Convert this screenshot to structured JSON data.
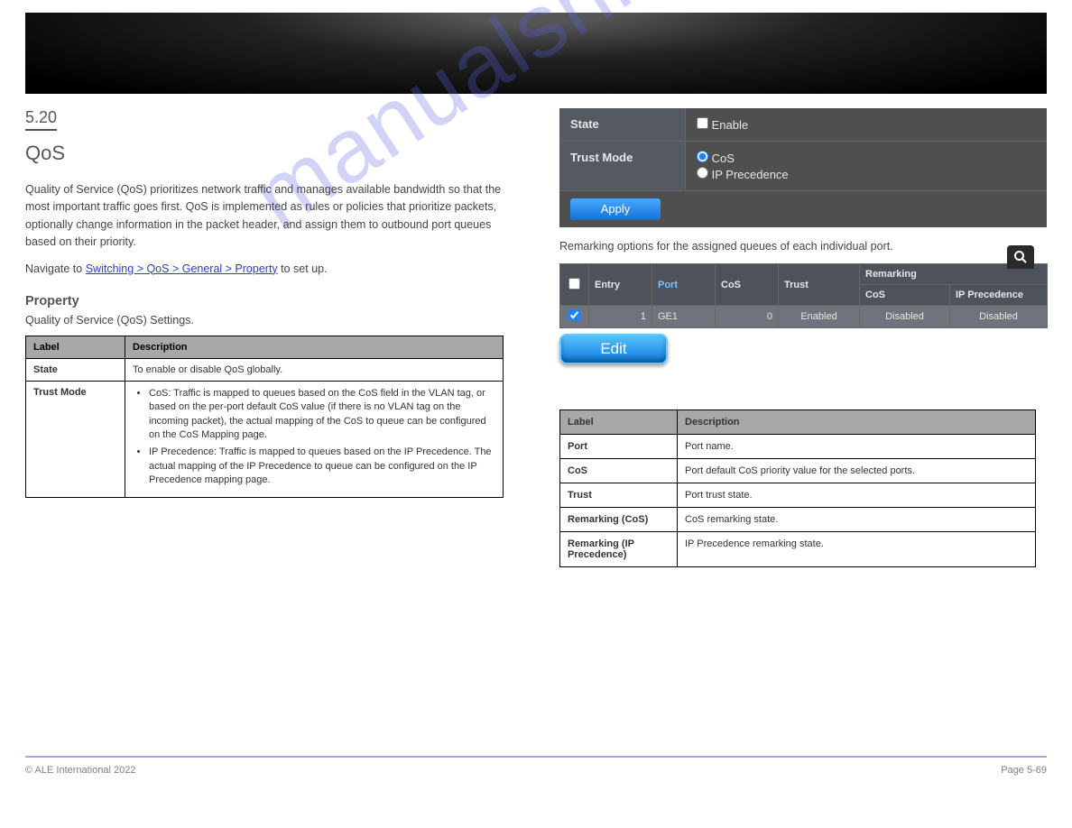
{
  "section": {
    "number": "5.20",
    "title": "QoS",
    "intro1": "Quality of Service (QoS) prioritizes network traffic and manages available bandwidth so that the most important traffic goes first. QoS is implemented as rules or policies that prioritize packets, optionally change information in the packet header, and assign them to outbound port queues based on their priority.",
    "intro2_pre": "Navigate to ",
    "intro2_link": "Switching > QoS > General > Property",
    "intro2_post": " to set up."
  },
  "left_sub": {
    "heading": "Property",
    "sub": "Quality of Service (QoS) Settings.",
    "table": {
      "head_label": "Label",
      "head_desc": "Description",
      "row1_label": "State",
      "row1_desc": "To enable or disable QoS globally.",
      "row2_label": "Trust Mode",
      "row2_items": [
        "CoS: Traffic is mapped to queues based on the CoS field in the VLAN tag, or based on the per-port default CoS value (if there is no VLAN tag on the incoming packet), the actual mapping of the CoS to queue can be configured on the CoS Mapping page.",
        "IP Precedence: Traffic is mapped to queues based on the IP Precedence. The actual mapping of the IP Precedence to queue can be configured on the IP Precedence mapping page."
      ]
    }
  },
  "settings": {
    "state_label": "State",
    "state_option": "Enable",
    "trust_label": "Trust Mode",
    "trust_cos": "CoS",
    "trust_ipprec": "IP Precedence",
    "apply": "Apply"
  },
  "right_caption": "Remarking options for the assigned queues of each individual port.",
  "grid": {
    "col_chk": "",
    "col_entry": "Entry",
    "col_port": "Port",
    "col_cos": "CoS",
    "col_trust": "Trust",
    "col_remarking": "Remarking",
    "col_rmk_cos": "CoS",
    "col_rmk_ipp": "IP Precedence",
    "row": {
      "entry": "1",
      "port": "GE1",
      "cos": "0",
      "trust": "Enabled",
      "rmk_cos": "Disabled",
      "rmk_ipp": "Disabled"
    },
    "edit": "Edit"
  },
  "port_table": {
    "head_label": "Label",
    "head_desc": "Description",
    "r1_label": "Port",
    "r1_desc": "Port name.",
    "r2_label": "CoS",
    "r2_desc": "Port default CoS priority value for the selected ports.",
    "r3_label": "Trust",
    "r3_desc": "Port trust state.",
    "r4_label": "Remarking (CoS)",
    "r4_desc": "CoS remarking state.",
    "r5_label": "Remarking (IP Precedence)",
    "r5_desc": "IP Precedence remarking state."
  },
  "footer": {
    "left": "© ALE International 2022",
    "right": "Page 5-69"
  }
}
